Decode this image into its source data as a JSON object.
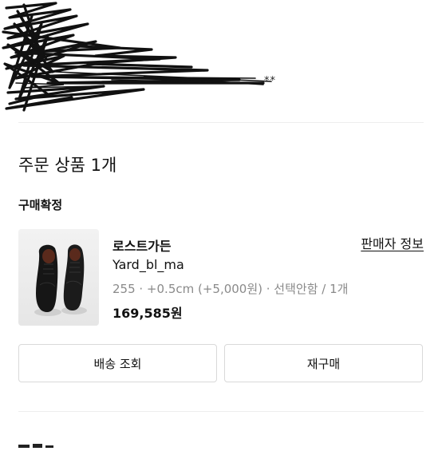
{
  "header": {
    "redacted_tail_text": "**"
  },
  "order": {
    "section_title": "주문 상품 1개",
    "status_label": "구매확정",
    "store_name": "로스트가든",
    "seller_info_link": "판매자 정보",
    "product_name": "Yard_bl_ma",
    "option_text": "255 · +0.5cm (+5,000원) · 선택안함 / 1개",
    "price": "169,585원",
    "thumbnail_icon": "black-leather-shoes"
  },
  "actions": {
    "track_delivery_label": "배송 조회",
    "reorder_label": "재구매"
  }
}
